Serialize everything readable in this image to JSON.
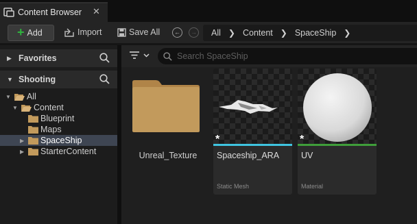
{
  "tab": {
    "title": "Content Browser",
    "close": "✕"
  },
  "toolbar": {
    "add_label": "Add",
    "import_label": "Import",
    "save_all_label": "Save All"
  },
  "breadcrumb": [
    "All",
    "Content",
    "SpaceShip"
  ],
  "left_panel": {
    "favorites_title": "Favorites",
    "shooting_title": "Shooting",
    "tree": [
      {
        "label": "All"
      },
      {
        "label": "Content"
      },
      {
        "label": "Blueprint"
      },
      {
        "label": "Maps"
      },
      {
        "label": "SpaceShip"
      },
      {
        "label": "StarterContent"
      }
    ]
  },
  "search": {
    "placeholder": "Search SpaceShip"
  },
  "assets": {
    "folder": {
      "name": "Unreal_Texture"
    },
    "items": [
      {
        "name": "Spaceship_ARA",
        "type": "Static Mesh",
        "color": "#3fc4e0"
      },
      {
        "name": "UV",
        "type": "Material",
        "color": "#3f9e3a"
      }
    ]
  },
  "colors": {
    "add_plus": "#2fb33e",
    "selection": "#3e4552",
    "folder": "#c29a5c"
  }
}
